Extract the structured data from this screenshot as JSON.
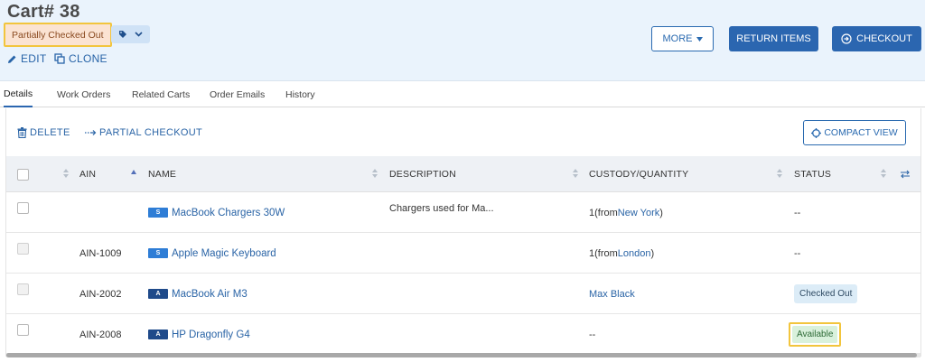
{
  "header": {
    "title": "Cart# 38",
    "status": "Partially Checked Out",
    "edit_label": "EDIT",
    "clone_label": "CLONE",
    "more_label": "MORE",
    "return_label": "RETURN ITEMS",
    "checkout_label": "CHECKOUT"
  },
  "tabs": [
    {
      "label": "Details",
      "active": true
    },
    {
      "label": "Work Orders"
    },
    {
      "label": "Related Carts"
    },
    {
      "label": "Order Emails"
    },
    {
      "label": "History"
    }
  ],
  "toolbar": {
    "delete_label": "DELETE",
    "partial_label": "PARTIAL CHECKOUT",
    "compact_label": "COMPACT VIEW"
  },
  "table": {
    "columns": [
      "AIN",
      "NAME",
      "DESCRIPTION",
      "CUSTODY/QUANTITY",
      "STATUS"
    ],
    "rows": [
      {
        "ain": "",
        "type": "S",
        "name": "MacBook Chargers 30W",
        "description": "Chargers used for Ma...",
        "qty_prefix": "1(from ",
        "location": "New York",
        "qty_suffix": ")",
        "custody": "",
        "status": "--"
      },
      {
        "ain": "AIN-1009",
        "type": "S",
        "name": "Apple Magic Keyboard",
        "description": "",
        "qty_prefix": "1(from ",
        "location": "London",
        "qty_suffix": ")",
        "custody": "",
        "status": "--"
      },
      {
        "ain": "AIN-2002",
        "type": "A",
        "name": "MacBook Air M3",
        "description": "",
        "qty_prefix": "",
        "location": "",
        "qty_suffix": "",
        "custody": "Max Black",
        "status": "Checked Out"
      },
      {
        "ain": "AIN-2008",
        "type": "A",
        "name": "HP Dragonfly G4",
        "description": "",
        "qty_prefix": "",
        "location": "",
        "qty_suffix": "",
        "custody": "--",
        "status": "Available"
      }
    ]
  },
  "colors": {
    "primary": "#2b66b0",
    "header_bg": "#eaf3fc",
    "highlight": "#f2c53d"
  }
}
